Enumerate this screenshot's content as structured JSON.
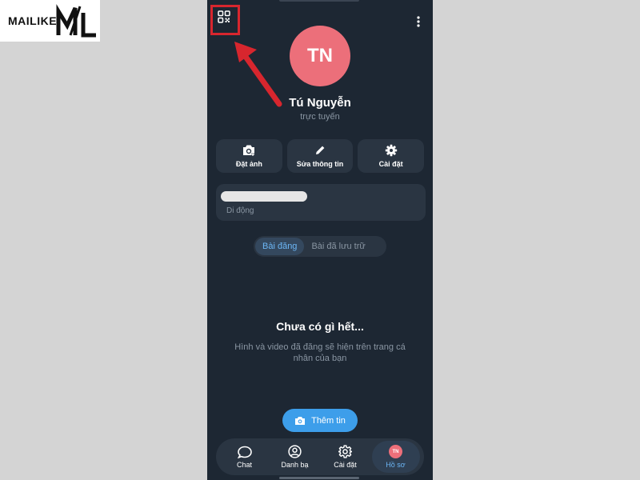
{
  "watermark": {
    "brand": "MAILIKE",
    "mark": "ML"
  },
  "profile": {
    "initials": "TN",
    "name": "Tú Nguyễn",
    "status": "trực tuyến",
    "avatar_color": "#ec6f7a"
  },
  "actions": [
    {
      "label": "Đặt ảnh",
      "icon": "camera-icon"
    },
    {
      "label": "Sửa thông tin",
      "icon": "pencil-icon"
    },
    {
      "label": "Cài đặt",
      "icon": "gear-icon"
    }
  ],
  "info": {
    "phone_label": "Di động"
  },
  "tabs": [
    {
      "label": "Bài đăng",
      "active": true
    },
    {
      "label": "Bài đã lưu trữ",
      "active": false
    }
  ],
  "empty_state": {
    "title": "Chưa có gì hết...",
    "description": "Hình và video đã đăng sẽ hiện trên trang cá nhân của bạn"
  },
  "add_story": {
    "label": "Thêm tin",
    "icon": "camera-icon"
  },
  "bottom_nav": [
    {
      "label": "Chat",
      "icon": "chat-icon",
      "active": false
    },
    {
      "label": "Danh bạ",
      "icon": "contacts-icon",
      "active": false
    },
    {
      "label": "Cài đặt",
      "icon": "gear-icon",
      "active": false
    },
    {
      "label": "Hồ sơ",
      "icon": "profile-avatar",
      "active": true,
      "initials": "TN"
    }
  ],
  "colors": {
    "background": "#1d2733",
    "card": "#2a3542",
    "accent": "#3d9eea",
    "highlight": "#d7262e"
  }
}
